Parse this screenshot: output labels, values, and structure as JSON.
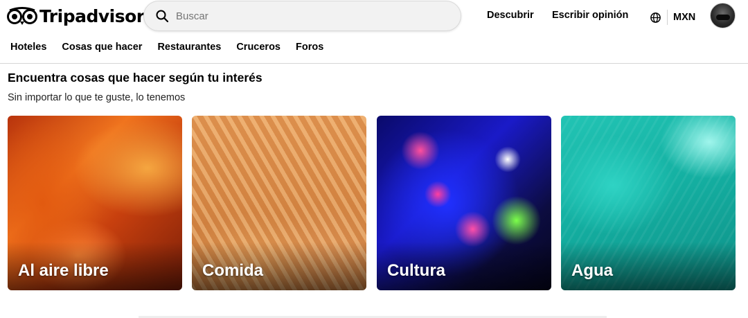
{
  "brand": {
    "name": "Tripadvisor",
    "color": "#000000",
    "icon": "owl-logo-icon"
  },
  "search": {
    "placeholder": "Buscar",
    "value": "",
    "icon": "search-icon"
  },
  "header_links": {
    "discover": "Descubrir",
    "review": "Escribir opinión"
  },
  "locale": {
    "icon": "globe-icon",
    "currency": "MXN"
  },
  "nav": [
    "Hoteles",
    "Cosas que hacer",
    "Restaurantes",
    "Cruceros",
    "Foros"
  ],
  "section": {
    "title": "Encuentra cosas que hacer según tu interés",
    "subtitle": "Sin importar lo que te guste, lo tenemos"
  },
  "cards": [
    {
      "label": "Al aire libre"
    },
    {
      "label": "Comida"
    },
    {
      "label": "Cultura"
    },
    {
      "label": "Agua"
    }
  ]
}
